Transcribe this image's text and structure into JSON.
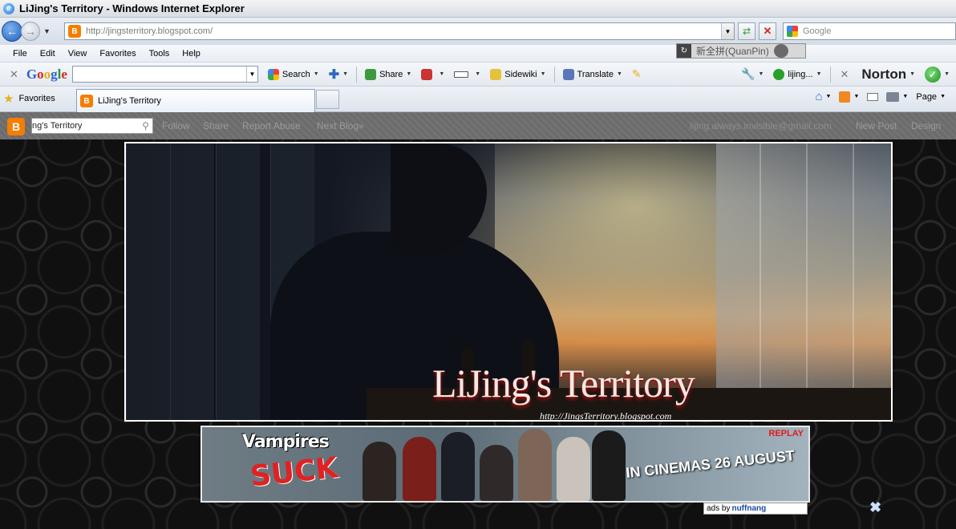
{
  "window": {
    "title": "LiJing's Territory - Windows Internet Explorer"
  },
  "address": {
    "url": "http://jingsterritory.blogspot.com/"
  },
  "search": {
    "placeholder": "Google"
  },
  "menu": [
    "File",
    "Edit",
    "View",
    "Favorites",
    "Tools",
    "Help"
  ],
  "ime": {
    "label": "新全拼(QuanPin)"
  },
  "google_toolbar": {
    "logo": "Google",
    "search_label": "Search",
    "share_label": "Share",
    "sidewiki_label": "Sidewiki",
    "translate_label": "Translate",
    "account_label": "lijing...",
    "norton_label": "Norton"
  },
  "favorites": {
    "label": "Favorites"
  },
  "tab": {
    "title": "LiJing's Territory"
  },
  "commandbar": {
    "page_label": "Page"
  },
  "blogger_navbar": {
    "search_value": "ng's Territory",
    "links": [
      "Follow",
      "Share",
      "Report Abuse",
      "Next Blog»"
    ],
    "email": "lijing.always.invisible@gmail.com",
    "new_post": "New Post",
    "design": "Design"
  },
  "header": {
    "blog_title": "LiJing's Territory",
    "blog_url": "http://JingsTerritory.blogspot.com"
  },
  "ad": {
    "title_line1": "Vampires",
    "title_line2": "SUCK",
    "replay": "REPLAY",
    "tagline": "IN CINEMAS 26 AUGUST",
    "ads_by": "ads by",
    "network": "nuffnang"
  },
  "colors": {
    "blogger_orange": "#f57d00",
    "ad_red": "#e21b1b",
    "navbar_gray": "#6b6b6b"
  }
}
